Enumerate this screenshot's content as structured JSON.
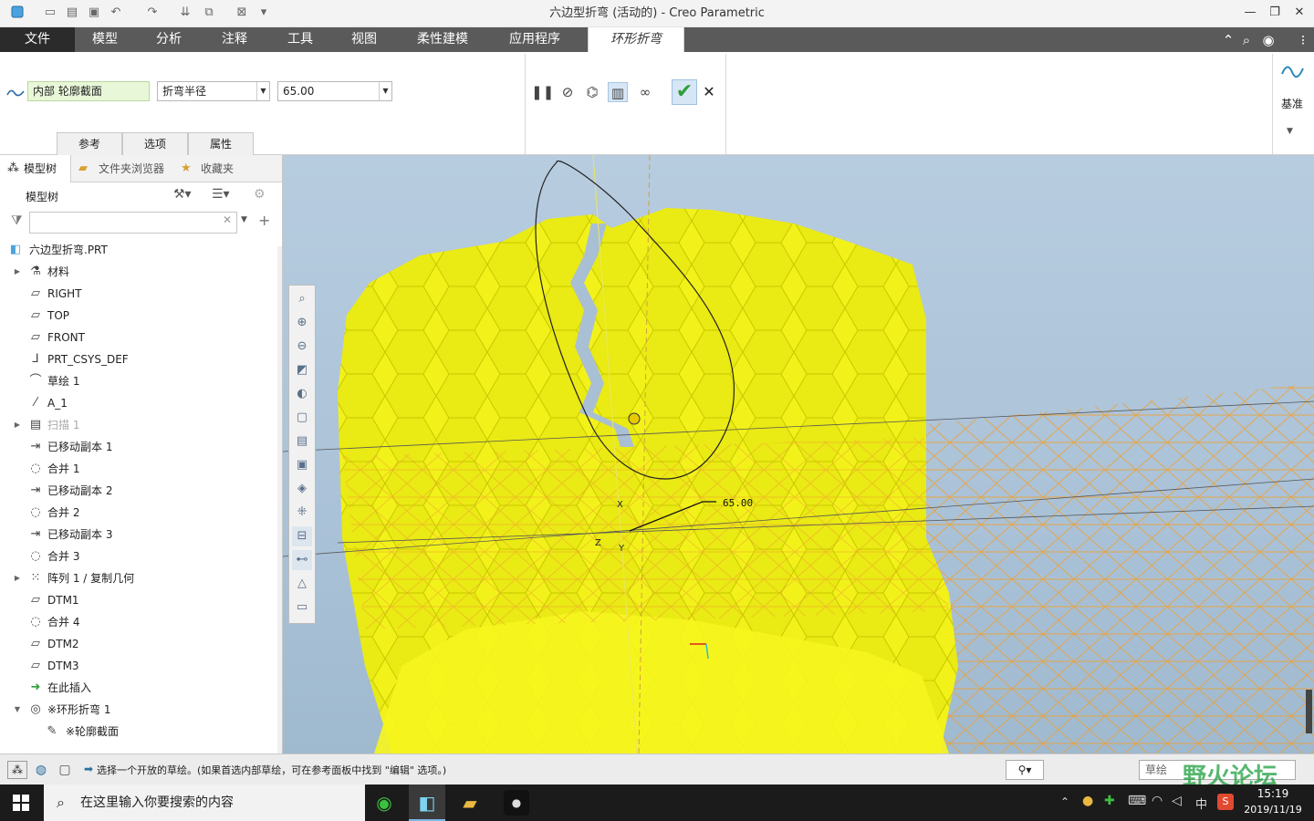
{
  "window": {
    "title": "六边型折弯 (活动的) - Creo Parametric"
  },
  "ribbon": {
    "file_tab": "文件",
    "tabs": [
      "模型",
      "分析",
      "注释",
      "工具",
      "视图",
      "柔性建模",
      "应用程序"
    ],
    "active_tab": "环形折弯"
  },
  "dashboard": {
    "section_field": "内部 轮廓截面",
    "bend_type": "折弯半径",
    "radius_value": "65.00",
    "subtabs": [
      "参考",
      "选项",
      "属性"
    ],
    "datum_label": "基准"
  },
  "left_panel": {
    "tabs": [
      "模型树",
      "文件夹浏览器",
      "收藏夹"
    ],
    "header": "模型树",
    "search_placeholder": "",
    "root": "六边型折弯.PRT",
    "items": [
      {
        "label": "材料",
        "icon": "material-icon",
        "expand": true
      },
      {
        "label": "RIGHT",
        "icon": "datum-plane-icon"
      },
      {
        "label": "TOP",
        "icon": "datum-plane-icon"
      },
      {
        "label": "FRONT",
        "icon": "datum-plane-icon"
      },
      {
        "label": "PRT_CSYS_DEF",
        "icon": "csys-icon"
      },
      {
        "label": "草绘 1",
        "icon": "sketch-icon"
      },
      {
        "label": "A_1",
        "icon": "axis-icon"
      },
      {
        "label": "扫描 1",
        "icon": "sweep-icon",
        "expand": true,
        "dim": true
      },
      {
        "label": "已移动副本 1",
        "icon": "moved-copy-icon"
      },
      {
        "label": "合并 1",
        "icon": "merge-icon"
      },
      {
        "label": "已移动副本 2",
        "icon": "moved-copy-icon"
      },
      {
        "label": "合并 2",
        "icon": "merge-icon"
      },
      {
        "label": "已移动副本 3",
        "icon": "moved-copy-icon"
      },
      {
        "label": "合并 3",
        "icon": "merge-icon"
      },
      {
        "label": "阵列 1 / 复制几何",
        "icon": "pattern-icon",
        "expand": true
      },
      {
        "label": "DTM1",
        "icon": "datum-plane-icon"
      },
      {
        "label": "合并 4",
        "icon": "merge-icon"
      },
      {
        "label": "DTM2",
        "icon": "datum-plane-icon"
      },
      {
        "label": "DTM3",
        "icon": "datum-plane-icon"
      },
      {
        "label": "在此插入",
        "icon": "insert-here-icon"
      },
      {
        "label": "※环形折弯 1",
        "icon": "toroidal-bend-icon",
        "expand": true,
        "open": true
      },
      {
        "label": "※轮廓截面",
        "icon": "sketch-edit-icon",
        "child": true
      }
    ]
  },
  "viewport": {
    "dimension_label": "65.00",
    "axis_labels": [
      "X",
      "Z",
      "Y"
    ]
  },
  "statusbar": {
    "message": "选择一个开放的草绘。(如果首选内部草绘，可在参考面板中找到 \"编辑\" 选项。)",
    "filter": "草绘",
    "watermark": "野火论坛"
  },
  "taskbar": {
    "search_text": "在这里输入你要搜索的内容",
    "time": "15:19",
    "date": "2019/11/19",
    "ime": "中"
  },
  "colors": {
    "tab_bar": "#5a5a5a",
    "part_yellow": "#f2f21a",
    "grid_orange": "#f0a030",
    "accept_green": "#2e9e3a"
  }
}
